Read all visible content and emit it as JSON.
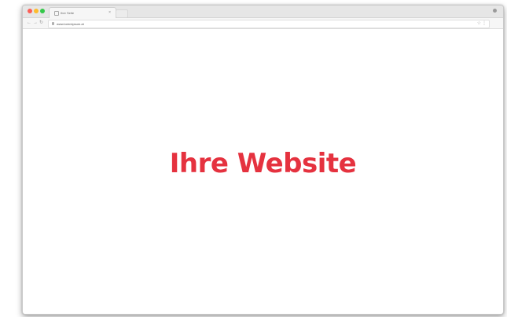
{
  "browser": {
    "tab": {
      "title": "Ihre Seite",
      "close": "×"
    },
    "nav": {
      "back": "←",
      "forward": "→",
      "reload": "↻"
    },
    "address_bar": {
      "url": "www.loremipsum.at"
    },
    "icons": [
      "close-dot",
      "minimize-dot",
      "maximize-dot",
      "favicon",
      "tab-close-icon",
      "new-tab",
      "profile-icon",
      "lock-icon",
      "star-icon",
      "menu-icon"
    ]
  },
  "page": {
    "headline": "Ihre Website",
    "headline_color": "#e5323f"
  }
}
